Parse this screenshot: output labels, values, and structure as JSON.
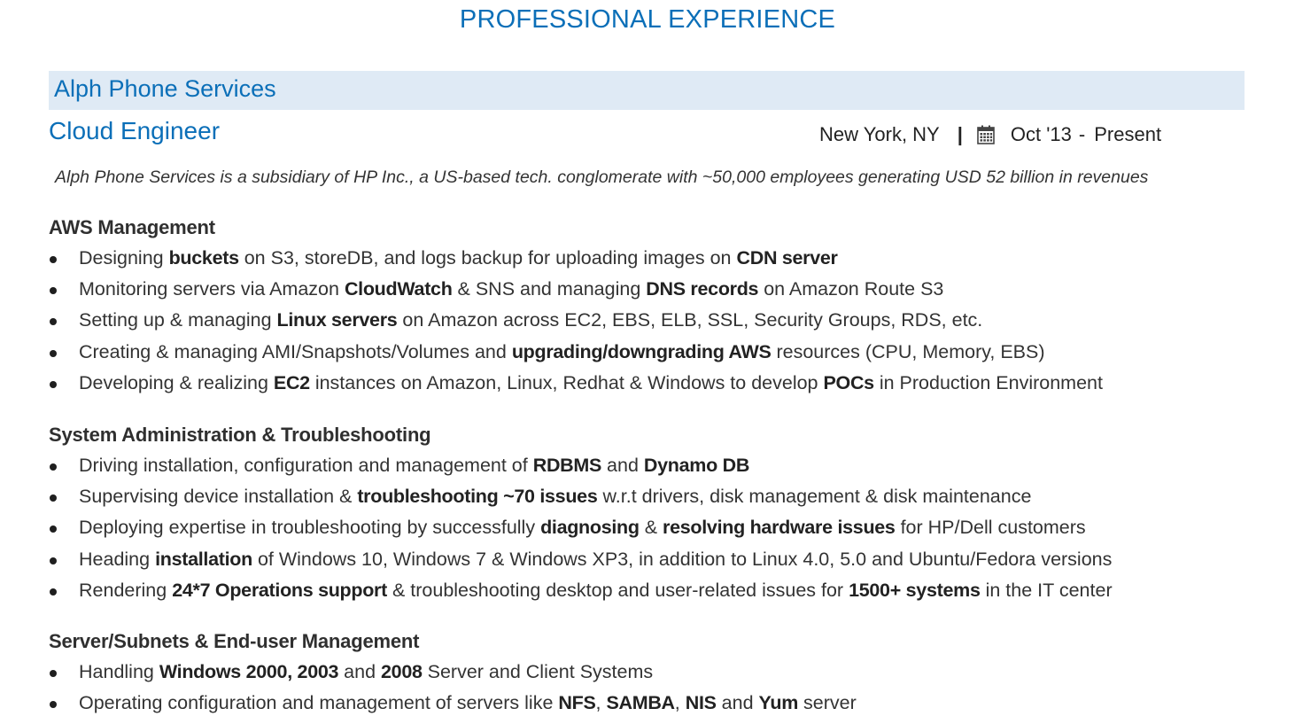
{
  "page": {
    "title": "PROFESSIONAL EXPERIENCE"
  },
  "experience": {
    "company": "Alph Phone Services",
    "role": "Cloud Engineer",
    "location": "New York, NY",
    "separator": "|",
    "icon": "calendar-icon",
    "start": "Oct '13",
    "dash": "-",
    "end": "Present",
    "summary": "Alph Phone Services is a subsidiary of HP Inc., a US-based tech. conglomerate with ~50,000 employees generating USD 52 billion in revenues",
    "colors": {
      "accent": "#0b6fb8",
      "company_bar": "#dfeaf5",
      "text": "#333333"
    }
  },
  "sections": [
    {
      "heading": "AWS Management",
      "bullets": [
        [
          {
            "t": "Designing "
          },
          {
            "t": "buckets",
            "b": true
          },
          {
            "t": " on S3, storeDB, and logs backup for uploading images on "
          },
          {
            "t": "CDN server",
            "b": true
          }
        ],
        [
          {
            "t": "Monitoring servers via Amazon "
          },
          {
            "t": "CloudWatch",
            "b": true
          },
          {
            "t": " & SNS and managing "
          },
          {
            "t": "DNS records",
            "b": true
          },
          {
            "t": " on Amazon Route S3"
          }
        ],
        [
          {
            "t": "Setting up & managing "
          },
          {
            "t": "Linux servers",
            "b": true
          },
          {
            "t": " on Amazon across EC2, EBS, ELB, SSL, Security Groups, RDS, etc."
          }
        ],
        [
          {
            "t": "Creating & managing AMI/Snapshots/Volumes and "
          },
          {
            "t": "upgrading/downgrading AWS",
            "b": true
          },
          {
            "t": " resources (CPU, Memory, EBS)"
          }
        ],
        [
          {
            "t": "Developing & realizing "
          },
          {
            "t": "EC2",
            "b": true
          },
          {
            "t": " instances on Amazon, Linux, Redhat & Windows to develop "
          },
          {
            "t": "POCs",
            "b": true
          },
          {
            "t": " in Production Environment"
          }
        ]
      ]
    },
    {
      "heading": "System Administration & Troubleshooting",
      "bullets": [
        [
          {
            "t": "Driving installation, configuration and management of "
          },
          {
            "t": "RDBMS",
            "b": true
          },
          {
            "t": " and "
          },
          {
            "t": "Dynamo DB",
            "b": true
          }
        ],
        [
          {
            "t": "Supervising device installation & "
          },
          {
            "t": "troubleshooting ~70 issues",
            "b": true
          },
          {
            "t": " w.r.t drivers, disk management & disk maintenance"
          }
        ],
        [
          {
            "t": "Deploying expertise in troubleshooting by successfully "
          },
          {
            "t": "diagnosing",
            "b": true
          },
          {
            "t": " & "
          },
          {
            "t": "resolving hardware issues",
            "b": true
          },
          {
            "t": " for HP/Dell customers"
          }
        ],
        [
          {
            "t": "Heading "
          },
          {
            "t": "installation",
            "b": true
          },
          {
            "t": " of Windows 10, Windows 7 & Windows XP3, in addition to Linux 4.0, 5.0 and Ubuntu/Fedora versions"
          }
        ],
        [
          {
            "t": "Rendering "
          },
          {
            "t": "24*7 Operations support",
            "b": true
          },
          {
            "t": " & troubleshooting desktop and user-related issues for "
          },
          {
            "t": "1500+ systems",
            "b": true
          },
          {
            "t": " in the IT center"
          }
        ]
      ]
    },
    {
      "heading": "Server/Subnets & End-user Management",
      "bullets": [
        [
          {
            "t": "Handling "
          },
          {
            "t": "Windows 2000, 2003",
            "b": true
          },
          {
            "t": " and "
          },
          {
            "t": "2008",
            "b": true
          },
          {
            "t": " Server and Client Systems"
          }
        ],
        [
          {
            "t": "Operating configuration and management of servers like "
          },
          {
            "t": "NFS",
            "b": true
          },
          {
            "t": ", "
          },
          {
            "t": "SAMBA",
            "b": true
          },
          {
            "t": ", "
          },
          {
            "t": "NIS",
            "b": true
          },
          {
            "t": " and "
          },
          {
            "t": "Yum",
            "b": true
          },
          {
            "t": " server"
          }
        ]
      ]
    }
  ]
}
